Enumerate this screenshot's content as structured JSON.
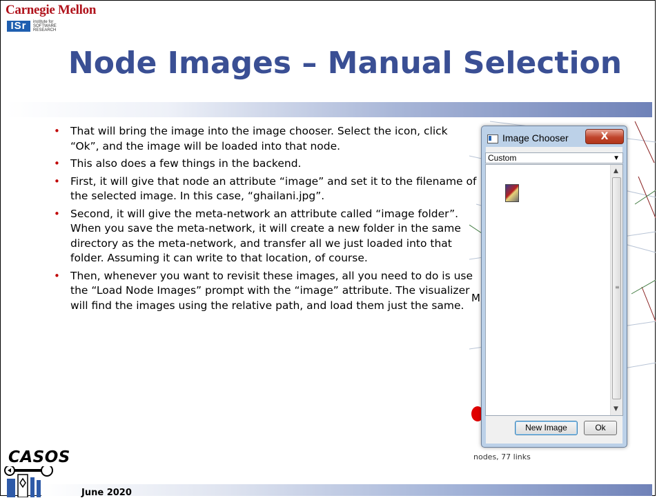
{
  "header": {
    "university": "Carnegie Mellon",
    "institute_abbr": "ISr",
    "institute_name": "institute for SOFTWARE RESEARCH"
  },
  "slide": {
    "title": "Node Images – Manual Selection",
    "bullets": [
      "That will bring the image into the image chooser.  Select the icon, click “Ok”, and the image will be loaded into that node.",
      "This also does a few things in the backend.",
      "First, it will give that node an attribute “image” and set it to the filename of the selected image.  In this case, “ghailani.jpg”.",
      "Second, it will give the meta-network an attribute called “image folder”.  When you save the meta-network, it will create a new folder in the same directory as the meta-network, and transfer all we just loaded into that folder.  Assuming it can write to that location, of course.",
      "Then, whenever you want to revisit these images, all you need to do is use the “Load Node Images” prompt with the “image” attribute.  The visualizer will find the images using the relative path, and load them just the same."
    ]
  },
  "dialog": {
    "title": "Image Chooser",
    "close_label": "X",
    "selected_folder": "Custom",
    "new_image_label": "New Image",
    "ok_label": "Ok"
  },
  "background_viz": {
    "node_label": "M",
    "status_text": "nodes, 77 links"
  },
  "footer": {
    "logo_text": "CASOS",
    "date": "June 2020"
  },
  "colors": {
    "title": "#3a4f94",
    "bullet": "#c00000",
    "cmu_red": "#b0121b",
    "isr_blue": "#1f5fb0"
  }
}
